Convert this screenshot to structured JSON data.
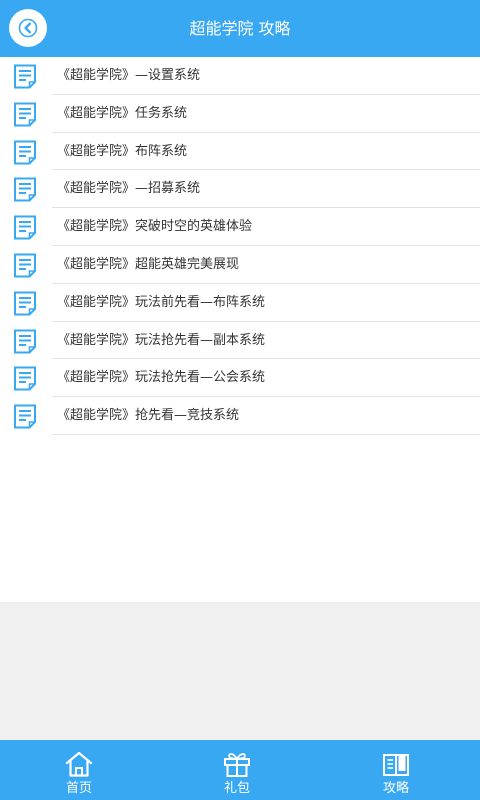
{
  "header": {
    "title": "超能学院 攻略",
    "back_icon": "chevron-left-icon"
  },
  "articles": [
    {
      "title": "《超能学院》—设置系统",
      "icon": "document-icon"
    },
    {
      "title": "《超能学院》任务系统",
      "icon": "document-icon"
    },
    {
      "title": "《超能学院》布阵系统",
      "icon": "document-icon"
    },
    {
      "title": "《超能学院》—招募系统",
      "icon": "document-icon"
    },
    {
      "title": "《超能学院》突破时空的英雄体验",
      "icon": "document-icon"
    },
    {
      "title": "《超能学院》超能英雄完美展现",
      "icon": "document-icon"
    },
    {
      "title": "《超能学院》玩法前先看—布阵系统",
      "icon": "document-icon"
    },
    {
      "title": "《超能学院》玩法抢先看—副本系统",
      "icon": "document-icon"
    },
    {
      "title": "《超能学院》玩法抢先看—公会系统",
      "icon": "document-icon"
    },
    {
      "title": "《超能学院》抢先看—竞技系统",
      "icon": "document-icon"
    }
  ],
  "tabbar": {
    "tabs": [
      {
        "label": "首页",
        "icon": "home-icon"
      },
      {
        "label": "礼包",
        "icon": "gift-icon"
      },
      {
        "label": "攻略",
        "icon": "book-icon"
      }
    ],
    "active": "攻略"
  },
  "colors": {
    "accent": "#39a8f2",
    "list_background": "#ffffff",
    "page_background": "#f0f0f0",
    "text": "#333333",
    "divider": "#e2e2e2"
  }
}
